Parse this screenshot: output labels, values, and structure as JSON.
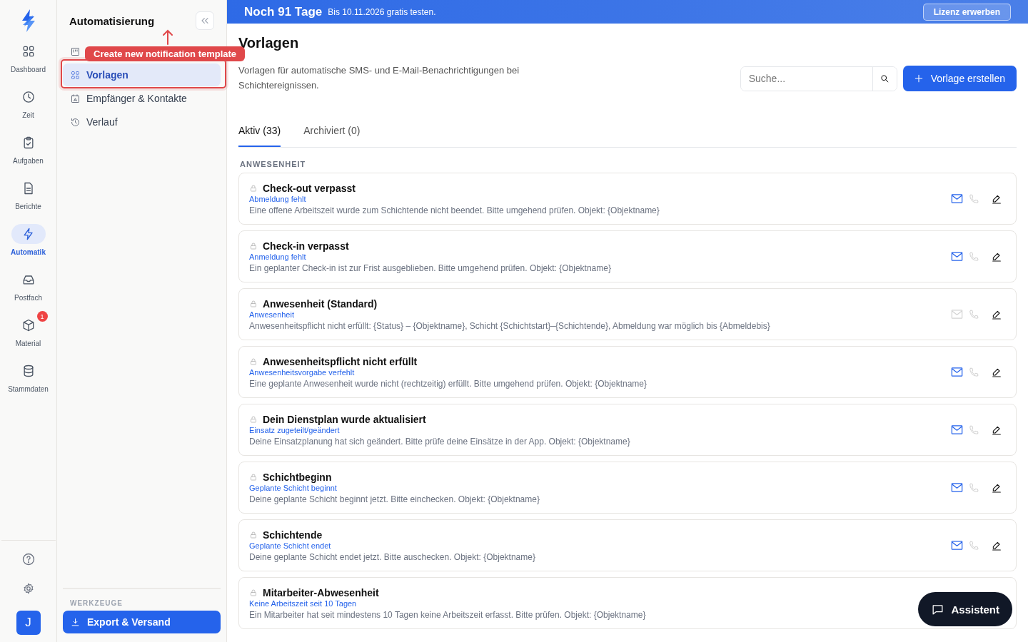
{
  "rail": {
    "items": [
      {
        "label": "Dashboard",
        "selected": false
      },
      {
        "label": "Zeit",
        "selected": false
      },
      {
        "label": "Aufgaben",
        "selected": false
      },
      {
        "label": "Berichte",
        "selected": false
      },
      {
        "label": "Automatik",
        "selected": true
      },
      {
        "label": "Postfach",
        "selected": false
      },
      {
        "label": "Material",
        "selected": false,
        "badge": "1"
      },
      {
        "label": "Stammdaten",
        "selected": false
      }
    ],
    "avatar": "J"
  },
  "sidebar": {
    "title": "Automatisierung",
    "items": [
      {
        "selected": false
      },
      {
        "label": "Vorlagen",
        "selected": true
      },
      {
        "label": "Empfänger & Kontakte",
        "selected": false
      },
      {
        "label": "Verlauf",
        "selected": false
      }
    ],
    "tools_heading": "WERKZEUGE",
    "tools_button": "Export & Versand"
  },
  "tooltip": "Create new notification template",
  "banner": {
    "title": "Noch 91 Tage",
    "text": "Bis 10.11.2026 gratis testen.",
    "button": "Lizenz erwerben"
  },
  "page": {
    "title": "Vorlagen",
    "description": "Vorlagen für automatische SMS- und E-Mail-Benachrichtigungen bei Schichtereignissen.",
    "search": {
      "placeholder": "Suche..."
    },
    "create_button": "Vorlage erstellen"
  },
  "tabs": [
    {
      "label": "Aktiv (33)",
      "selected": true
    },
    {
      "label": "Archiviert (0)",
      "selected": false
    }
  ],
  "section": "ANWESENHEIT",
  "templates": [
    {
      "title": "Check-out verpasst",
      "subtitle": "Abmeldung fehlt",
      "text": "Eine offene Arbeitszeit wurde zum Schichtende nicht beendet. Bitte umgehend prüfen. Objekt: {Objektname}",
      "email": true,
      "sms": false
    },
    {
      "title": "Check-in verpasst",
      "subtitle": "Anmeldung fehlt",
      "text": "Ein geplanter Check-in ist zur Frist ausgeblieben. Bitte umgehend prüfen. Objekt: {Objektname}",
      "email": true,
      "sms": false
    },
    {
      "title": "Anwesenheit (Standard)",
      "subtitle": "Anwesenheit",
      "text": "Anwesenheitspflicht nicht erfüllt: {Status} – {Objektname}, Schicht {Schichtstart}–{Schichtende}, Abmeldung war möglich bis {Abmeldebis}",
      "email": false,
      "sms": false
    },
    {
      "title": "Anwesenheitspflicht nicht erfüllt",
      "subtitle": "Anwesenheitsvorgabe verfehlt",
      "text": "Eine geplante Anwesenheit wurde nicht (rechtzeitig) erfüllt. Bitte umgehend prüfen. Objekt: {Objektname}",
      "email": true,
      "sms": false
    },
    {
      "title": "Dein Dienstplan wurde aktualisiert",
      "subtitle": "Einsatz zugeteilt/geändert",
      "text": "Deine Einsatzplanung hat sich geändert. Bitte prüfe deine Einsätze in der App. Objekt: {Objektname}",
      "email": true,
      "sms": false
    },
    {
      "title": "Schichtbeginn",
      "subtitle": "Geplante Schicht beginnt",
      "text": "Deine geplante Schicht beginnt jetzt. Bitte einchecken. Objekt: {Objektname}",
      "email": true,
      "sms": false
    },
    {
      "title": "Schichtende",
      "subtitle": "Geplante Schicht endet",
      "text": "Deine geplante Schicht endet jetzt. Bitte auschecken. Objekt: {Objektname}",
      "email": true,
      "sms": false
    },
    {
      "title": "Mitarbeiter-Abwesenheit",
      "subtitle": "Keine Arbeitszeit seit 10 Tagen",
      "text": "Ein Mitarbeiter hat seit mindestens 10 Tagen keine Arbeitszeit erfasst. Bitte prüfen. Objekt: {Objektname}"
    }
  ],
  "assistant": "Assistent"
}
